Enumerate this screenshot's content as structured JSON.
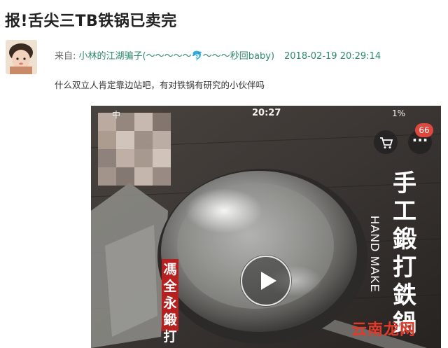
{
  "post": {
    "title": "报!舌尖三TB铁锅已卖完",
    "from_label": "来自: ",
    "author": "小林的江湖骗子(～～～～～🐬～～～秒回baby)",
    "date": "2018-02-19 20:29:14",
    "body": "什么双立人肯定靠边站吧，有对铁锅有研究的小伙伴吗"
  },
  "video": {
    "status_bar": {
      "carrier": "中",
      "time": "20:27",
      "battery": "1%"
    },
    "cart_icon": "cart-icon",
    "more_icon": "more-dots-icon",
    "more_label": "···",
    "badge_count": "66",
    "vertical_title": [
      "手",
      "工",
      "鍛",
      "打",
      "鉄",
      "鍋"
    ],
    "english_text": "HAND MAKE",
    "seal_text": [
      "馮",
      "全",
      "永",
      "鍛",
      "打"
    ],
    "play_icon": "play-icon",
    "watermark": "云南龙网"
  },
  "colors": {
    "link": "#2d8a6a",
    "badge": "#e0483e",
    "seal": "#b81f1f",
    "watermark": "#e23a2a"
  }
}
